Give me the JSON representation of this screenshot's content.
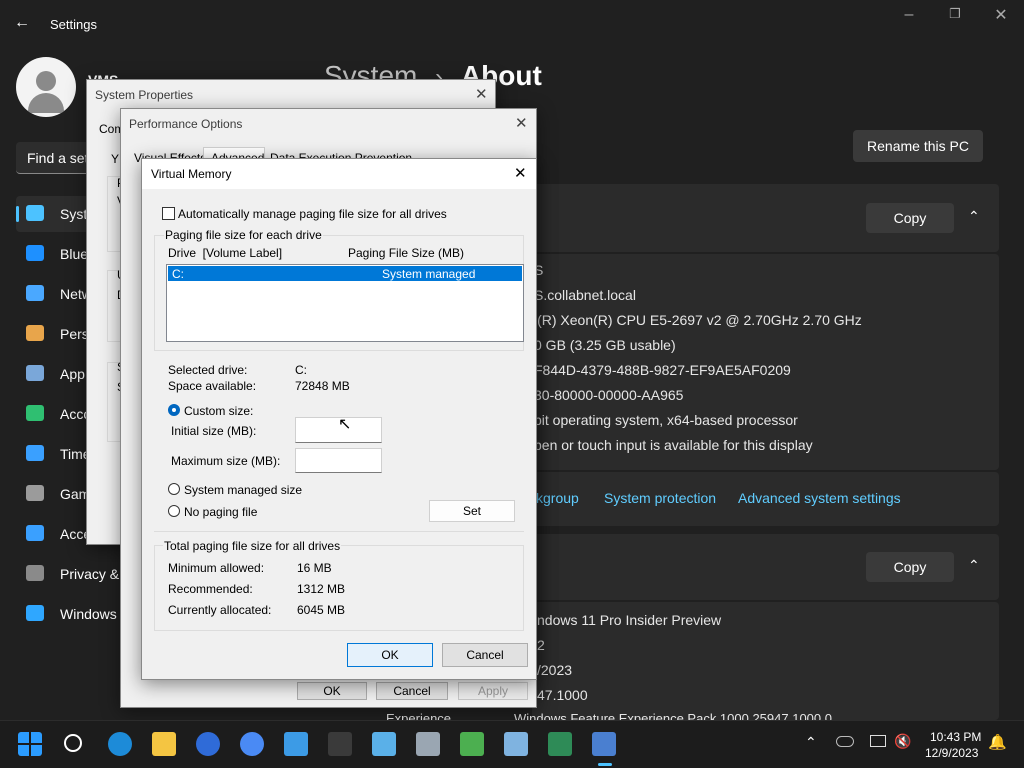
{
  "settings": {
    "title": "Settings",
    "profile_name": "VMS",
    "search_placeholder": "Find a set",
    "breadcrumb": {
      "parent": "System",
      "separator": "›",
      "current": "About"
    },
    "nav": [
      {
        "label": "System",
        "icon": "display-icon",
        "color": "#4cc2ff"
      },
      {
        "label": "Blue",
        "icon": "bluetooth-icon",
        "color": "#1e90ff"
      },
      {
        "label": "Netw",
        "icon": "wifi-icon",
        "color": "#4aa8ff"
      },
      {
        "label": "Pers",
        "icon": "brush-icon",
        "color": "#e8a54b"
      },
      {
        "label": "App",
        "icon": "apps-icon",
        "color": "#7aa7d9"
      },
      {
        "label": "Acco",
        "icon": "account-icon",
        "color": "#2fbf71"
      },
      {
        "label": "Time",
        "icon": "clock-globe-icon",
        "color": "#3aa0ff"
      },
      {
        "label": "Gam",
        "icon": "gamepad-icon",
        "color": "#9b9b9b"
      },
      {
        "label": "Acce",
        "icon": "accessibility-icon",
        "color": "#3aa0ff"
      },
      {
        "label": "Privacy &",
        "icon": "shield-icon",
        "color": "#8a8a8a"
      },
      {
        "label": "Windows",
        "icon": "sync-icon",
        "color": "#2fa7ff"
      }
    ],
    "rename_button": "Rename this PC",
    "copy_button": "Copy",
    "device_specs": [
      "S",
      "S.collabnet.local",
      "l(R) Xeon(R) CPU E5-2697 v2 @ 2.70GHz   2.70 GHz",
      "0 GB (3.25 GB usable)",
      "F844D-4379-488B-9827-EF9AE5AF0209",
      "30-80000-00000-AA965",
      "bit operating system, x64-based processor",
      "pen or touch input is available for this display"
    ],
    "related_links": [
      "kgroup",
      "System protection",
      "Advanced system settings"
    ],
    "windows_specs": [
      "ndows 11 Pro Insider Preview",
      "2",
      "/2023",
      "47.1000"
    ],
    "experience_label": "Experience",
    "experience_value": "Windows Feature Experience Pack 1000.25947.1000.0"
  },
  "system_properties": {
    "title": "System Properties",
    "tab_partial": "Com",
    "left_fragments": [
      "Y",
      "P",
      "V",
      "U",
      "D",
      "S",
      "S"
    ]
  },
  "performance_options": {
    "title": "Performance Options",
    "tabs": [
      "Visual Effects",
      "Advanced",
      "Data Execution Prevention"
    ],
    "buttons": {
      "ok": "OK",
      "cancel": "Cancel",
      "apply": "Apply"
    }
  },
  "virtual_memory": {
    "title": "Virtual Memory",
    "auto_manage_label": "Automatically manage paging file size for all drives",
    "auto_manage_checked": false,
    "group_title": "Paging file size for each drive",
    "columns": [
      "Drive  [Volume Label]",
      "Paging File Size (MB)"
    ],
    "drives": [
      {
        "drive": "C:",
        "size": "System managed",
        "selected": true
      }
    ],
    "selected_drive_label": "Selected drive:",
    "selected_drive_value": "C:",
    "space_available_label": "Space available:",
    "space_available_value": "72848 MB",
    "custom_size_label": "Custom size:",
    "initial_size_label": "Initial size (MB):",
    "initial_size_value": "",
    "maximum_size_label": "Maximum size (MB):",
    "maximum_size_value": "",
    "system_managed_label": "System managed size",
    "no_paging_label": "No paging file",
    "selected_option": "custom",
    "set_button": "Set",
    "total_group_title": "Total paging file size for all drives",
    "minimum_label": "Minimum allowed:",
    "minimum_value": "16 MB",
    "recommended_label": "Recommended:",
    "recommended_value": "1312 MB",
    "allocated_label": "Currently allocated:",
    "allocated_value": "6045 MB",
    "ok_button": "OK",
    "cancel_button": "Cancel"
  },
  "taskbar": {
    "apps": [
      {
        "name": "start-icon",
        "color": "#2b9cff"
      },
      {
        "name": "search-icon",
        "color": "#ffffff"
      },
      {
        "name": "edge-pre-icon",
        "color": "#1d8bd8"
      },
      {
        "name": "file-explorer-icon",
        "color": "#f4c542"
      },
      {
        "name": "firefox-icon",
        "color": "#2f6bd8"
      },
      {
        "name": "chrome-icon",
        "color": "#4a8af4"
      },
      {
        "name": "photos-icon",
        "color": "#3c9be6"
      },
      {
        "name": "terminal-icon",
        "color": "#3a3a3a"
      },
      {
        "name": "notepad-icon",
        "color": "#5ab0e8"
      },
      {
        "name": "settings-gear-icon",
        "color": "#9aa6b2"
      },
      {
        "name": "task-scheduler-icon",
        "color": "#4caf50"
      },
      {
        "name": "resource-monitor-icon",
        "color": "#7fb3e0"
      },
      {
        "name": "spreadsheet-icon",
        "color": "#2e8b57"
      },
      {
        "name": "system-properties-icon",
        "color": "#4a7fd0"
      }
    ],
    "time": "10:43 PM",
    "date": "12/9/2023"
  }
}
